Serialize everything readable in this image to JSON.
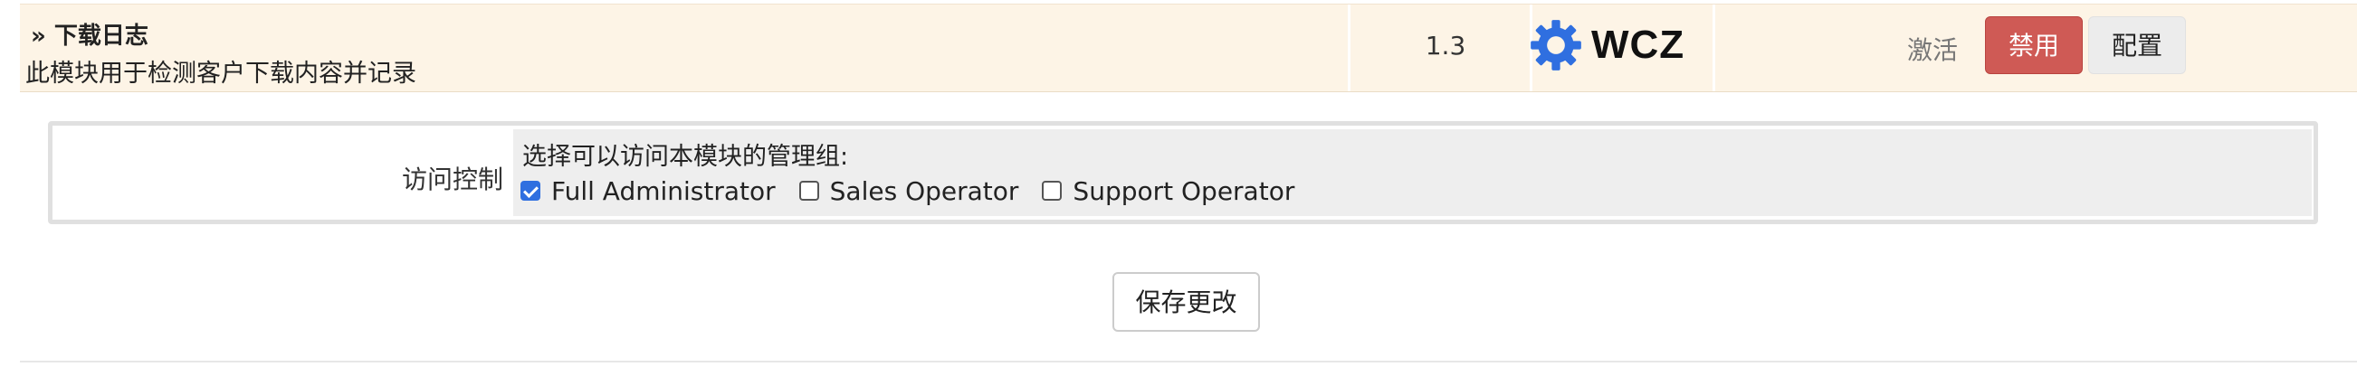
{
  "module": {
    "name": "» 下载日志",
    "description": "此模块用于检测客户下载内容并记录",
    "version": "1.3",
    "logo_text": "WCZ",
    "logo_icon": "gear-logo-icon",
    "status": "激活",
    "disable_label": "禁用",
    "configure_label": "配置"
  },
  "access_control": {
    "label": "访问控制",
    "prompt": "选择可以访问本模块的管理组:",
    "groups": [
      {
        "label": "Full Administrator",
        "checked": true
      },
      {
        "label": "Sales Operator",
        "checked": false
      },
      {
        "label": "Support Operator",
        "checked": false
      }
    ]
  },
  "save_label": "保存更改",
  "colors": {
    "row_background": "#fdf4e6",
    "danger": "#cf5a55",
    "checkbox_accent": "#2f6fe0",
    "logo_icon": "#2f6fe0"
  }
}
